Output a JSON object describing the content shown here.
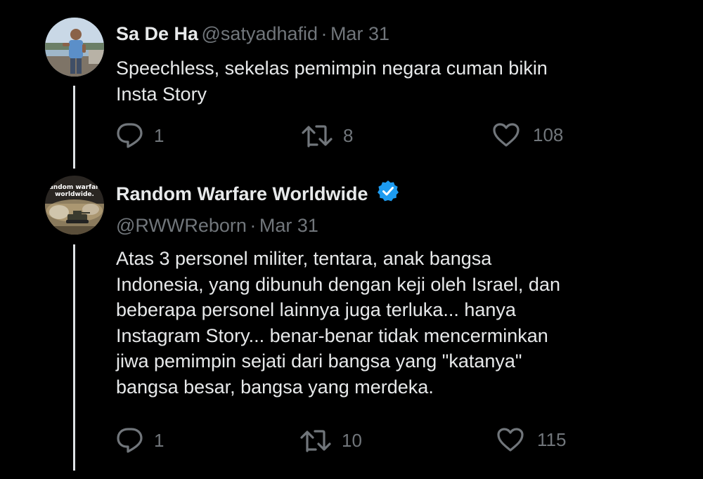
{
  "colors": {
    "background": "#000000",
    "primary_text": "#e7e9ea",
    "secondary_text": "#71767b",
    "verified": "#1d9bf0",
    "thread_line": "#dfe3e6"
  },
  "tweets": [
    {
      "name": "Sa De Ha",
      "handle": "@satyadhafid",
      "separator": "·",
      "date": "Mar 31",
      "text": "Speechless, sekelas pemimpin negara cuman bikin\nInsta Story",
      "replies": "1",
      "retweets": "8",
      "likes": "108"
    },
    {
      "name": "Random Warfare Worldwide",
      "verified_icon": "verified-badge-icon",
      "handle": "@RWWReborn",
      "separator": "·",
      "date": "Mar 31",
      "avatar_text": "random warfare worldwide.",
      "text": "Atas 3 personel militer, tentara, anak bangsa\nIndonesia, yang dibunuh dengan keji oleh Israel, dan\nbeberapa personel lainnya juga terluka... hanya\nInstagram Story... benar-benar tidak mencerminkan\njiwa pemimpin sejati dari bangsa yang \"katanya\"\nbangsa besar, bangsa yang merdeka.",
      "replies": "1",
      "retweets": "10",
      "likes": "115"
    }
  ]
}
